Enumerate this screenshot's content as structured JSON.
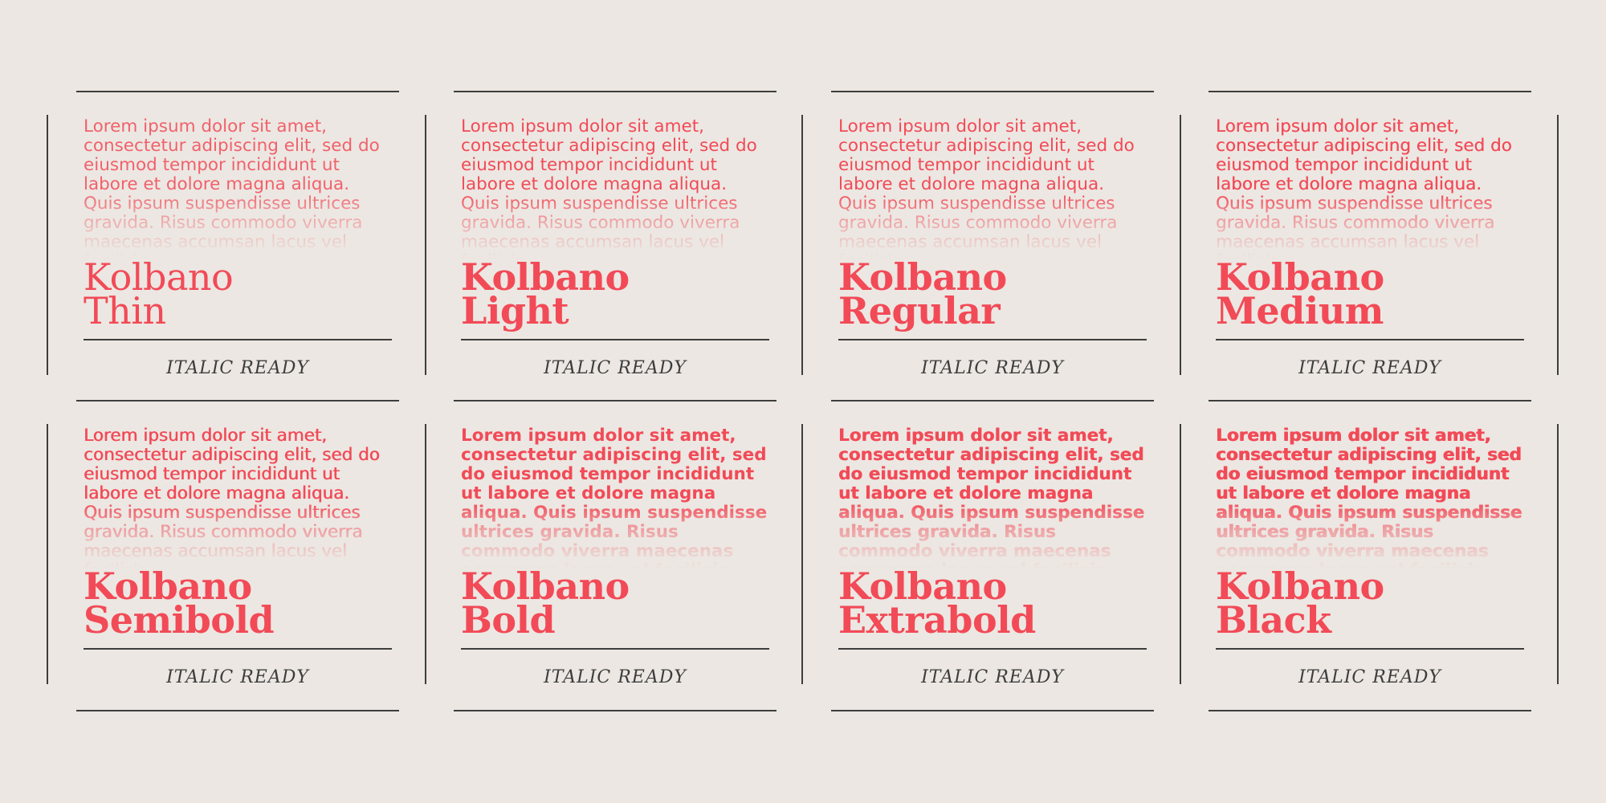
{
  "sample_text": "Lorem ipsum dolor sit amet, consectetur adipiscing elit, sed do eiusmod tempor incididunt ut labore et dolore magna aliqua. Quis ipsum suspendisse ultrices gravida. Risus commodo viverra maecenas accumsan lacus vel facilisis.",
  "family": "Kolbano",
  "italic_label": "ITALIC READY",
  "colors": {
    "accent": "#f24a57",
    "ink": "#3d3d3d",
    "background": "#ece7e2"
  },
  "styles": [
    {
      "family": "Kolbano",
      "weight_name": "Thin",
      "weight": 100
    },
    {
      "family": "Kolbano",
      "weight_name": "Light",
      "weight": 300
    },
    {
      "family": "Kolbano",
      "weight_name": "Regular",
      "weight": 400
    },
    {
      "family": "Kolbano",
      "weight_name": "Medium",
      "weight": 500
    },
    {
      "family": "Kolbano",
      "weight_name": "Semibold",
      "weight": 600
    },
    {
      "family": "Kolbano",
      "weight_name": "Bold",
      "weight": 700
    },
    {
      "family": "Kolbano",
      "weight_name": "Extrabold",
      "weight": 800
    },
    {
      "family": "Kolbano",
      "weight_name": "Black",
      "weight": 900
    }
  ]
}
